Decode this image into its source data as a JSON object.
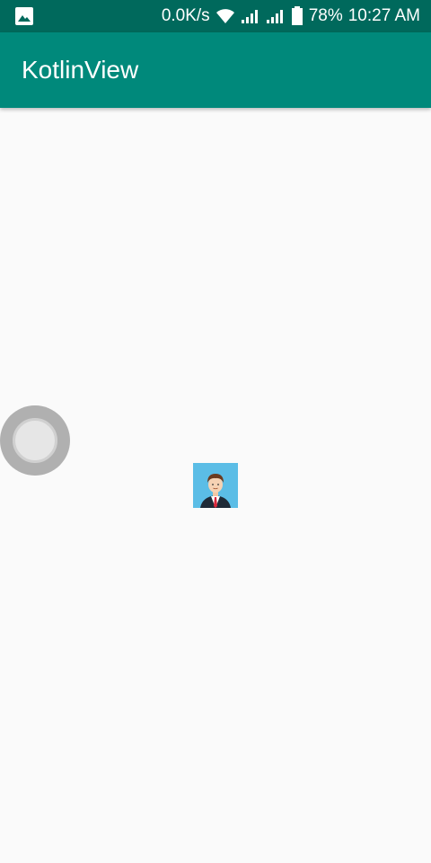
{
  "status_bar": {
    "network_speed": "0.0K/s",
    "battery_percent": "78%",
    "time": "10:27 AM",
    "icons": [
      "gallery-icon",
      "wifi-icon",
      "signal-icon",
      "signal-icon",
      "battery-icon"
    ]
  },
  "app_bar": {
    "title": "KotlinView"
  },
  "colors": {
    "status_bar": "#00695c",
    "app_bar": "#00897b",
    "background": "#fafafa",
    "avatar_bg": "#5bbde6"
  }
}
